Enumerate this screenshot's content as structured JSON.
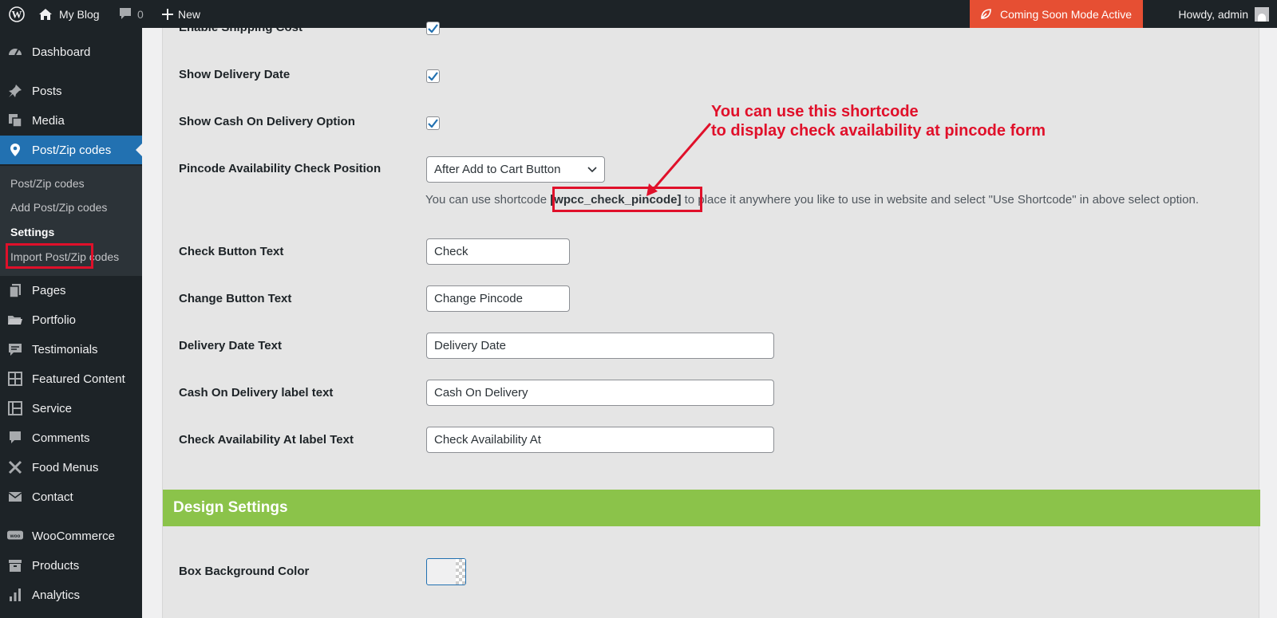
{
  "adminbar": {
    "site_name": "My Blog",
    "comments_count": "0",
    "new_label": "New",
    "coming_soon": "Coming Soon Mode Active",
    "howdy": "Howdy, admin"
  },
  "sidebar": {
    "items": [
      {
        "label": "Dashboard",
        "icon": "dashboard-icon"
      },
      {
        "label": "Posts",
        "icon": "pin-icon"
      },
      {
        "label": "Media",
        "icon": "media-icon"
      },
      {
        "label": "Post/Zip codes",
        "icon": "location-icon"
      },
      {
        "label": "Pages",
        "icon": "pages-icon"
      },
      {
        "label": "Portfolio",
        "icon": "folder-icon"
      },
      {
        "label": "Testimonials",
        "icon": "testimonial-icon"
      },
      {
        "label": "Featured Content",
        "icon": "grid-icon"
      },
      {
        "label": "Service",
        "icon": "service-icon"
      },
      {
        "label": "Comments",
        "icon": "comment-icon"
      },
      {
        "label": "Food Menus",
        "icon": "tools-icon"
      },
      {
        "label": "Contact",
        "icon": "mail-icon"
      },
      {
        "label": "WooCommerce",
        "icon": "woo-icon"
      },
      {
        "label": "Products",
        "icon": "archive-icon"
      },
      {
        "label": "Analytics",
        "icon": "bar-chart-icon"
      }
    ],
    "submenu": [
      "Post/Zip codes",
      "Add Post/Zip codes",
      "Settings",
      "Import Post/Zip codes"
    ]
  },
  "settings": {
    "cut_off_label": "Enable Shipping Cost",
    "show_delivery_date": "Show Delivery Date",
    "show_cod": "Show Cash On Delivery Option",
    "position_label": "Pincode Availability Check Position",
    "position_value": "After Add to Cart Button",
    "desc_before": "You can use shortcode ",
    "shortcode": "[wpcc_check_pincode]",
    "desc_after": " to place it anywhere you like to use in website and select \"Use Shortcode\" in above select option.",
    "check_button_label": "Check Button Text",
    "check_button_value": "Check",
    "change_button_label": "Change Button Text",
    "change_button_value": "Change Pincode",
    "delivery_date_label": "Delivery Date Text",
    "delivery_date_value": "Delivery Date",
    "cod_label": "Cash On Delivery label text",
    "cod_value": "Cash On Delivery",
    "check_at_label": "Check Availability At label Text",
    "check_at_value": "Check Availability At",
    "design_settings": "Design Settings",
    "box_bg_label": "Box Background Color"
  },
  "annotation": {
    "line1": "You can use this shortcode",
    "line2": "to display check availability at pincode form",
    "color": "#e0102a"
  },
  "colors": {
    "adminbar": "#1d2327",
    "accent": "#2271b1",
    "coming_soon": "#e64f33",
    "design_bar": "#8bc34a"
  }
}
